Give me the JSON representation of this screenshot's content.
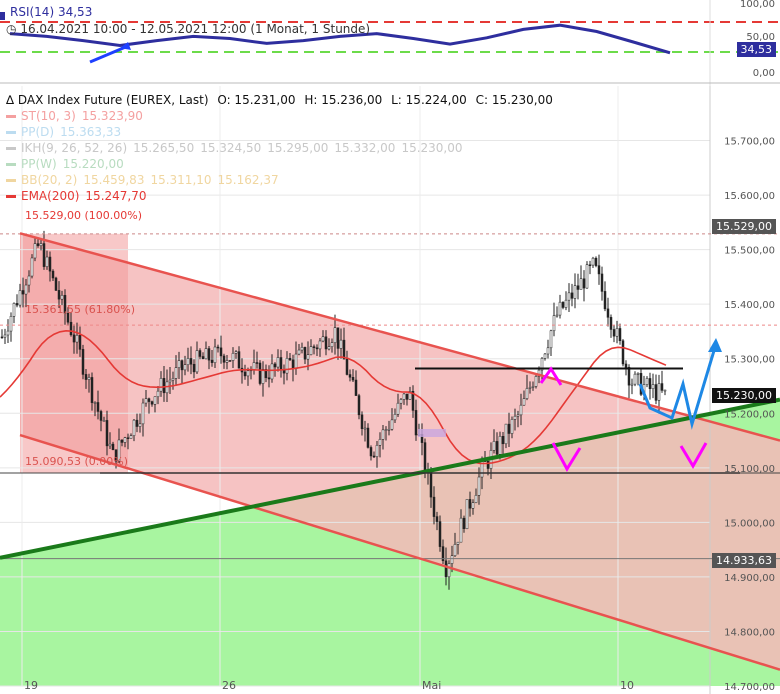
{
  "rsi": {
    "label": "RSI(14)",
    "value": "34,53",
    "period": "16.04.2021 10:00 - 12.05.2021 12:00",
    "resolution": "(1 Monat, 1 Stunde)",
    "axis_ticks": [
      "100,00",
      "50,00",
      "0,00"
    ],
    "badge": "34,53",
    "color": "#2e2e9e"
  },
  "main": {
    "title": "DAX Index Future (EUREX, Last)",
    "ohlc": {
      "o": "O: 15.231,00",
      "h": "H: 15.236,00",
      "l": "L: 15.224,00",
      "c": "C: 15.230,00"
    },
    "legend": [
      {
        "name": "ST(10, 3)",
        "vals": [
          "15.323,90"
        ],
        "color": "#f4a0a0"
      },
      {
        "name": "PP(D)",
        "vals": [
          "15.363,33"
        ],
        "color": "#bcdcf0"
      },
      {
        "name": "IKH(9, 26, 52, 26)",
        "vals": [
          "15.265,50",
          "15.324,50",
          "15.295,00",
          "15.332,00",
          "15.230,00"
        ],
        "color": "#c8c8c8"
      },
      {
        "name": "PP(W)",
        "vals": [
          "15.220,00"
        ],
        "color": "#b8dcc0"
      },
      {
        "name": "BB(20, 2)",
        "vals": [
          "15.459,83",
          "15.311,10",
          "15.162,37"
        ],
        "color": "#f0d6a0"
      },
      {
        "name": "EMA(200)",
        "vals": [
          "15.247,70"
        ],
        "color": "#e53935"
      }
    ],
    "fib_top": "15.529,00 (100.00%)",
    "fib_mid": "15.361,55 (61.80%)",
    "fib_low": "15.090,53 (0.00%)"
  },
  "tags": {
    "high": "15.529,00",
    "last": "15.230,00",
    "low": "14.933,63"
  },
  "colors": {
    "channel": "#e8534f",
    "trend": "#1a7a1a",
    "forecast": "#1e88e5",
    "arrows": "#ff00ff",
    "candles": "#222222",
    "green_area": "#a8f5a0",
    "pink_fill": "#f5b8b8"
  },
  "chart_data": {
    "type": "candlestick",
    "title": "DAX Index Future (EUREX, Last)",
    "x_ticks": [
      "19",
      "26",
      "Mai",
      "10"
    ],
    "y_ticks": [
      "15.700,00",
      "15.600,00",
      "15.500,00",
      "15.400,00",
      "15.300,00",
      "15.200,00",
      "15.100,00",
      "15.000,00",
      "14.900,00",
      "14.800,00",
      "14.700,00"
    ],
    "y_range": [
      14700,
      15800
    ],
    "price_series": [
      {
        "t": "16.04",
        "close": 15340
      },
      {
        "t": "19.04",
        "close": 15510
      },
      {
        "t": "20.04",
        "close": 15330
      },
      {
        "t": "21.04",
        "close": 15120
      },
      {
        "t": "22.04",
        "close": 15230
      },
      {
        "t": "23.04",
        "close": 15290
      },
      {
        "t": "26.04",
        "close": 15310
      },
      {
        "t": "27.04",
        "close": 15270
      },
      {
        "t": "28.04",
        "close": 15300
      },
      {
        "t": "29.04",
        "close": 15350
      },
      {
        "t": "30.04",
        "close": 15130
      },
      {
        "t": "03.05",
        "close": 15240
      },
      {
        "t": "04.05",
        "close": 14920
      },
      {
        "t": "05.05",
        "close": 15100
      },
      {
        "t": "06.05",
        "close": 15200
      },
      {
        "t": "07.05",
        "close": 15380
      },
      {
        "t": "10.05",
        "close": 15470
      },
      {
        "t": "11.05",
        "close": 15260
      },
      {
        "t": "12.05",
        "close": 15230
      }
    ],
    "rsi_series": [
      62,
      58,
      52,
      45,
      52,
      58,
      55,
      48,
      52,
      58,
      62,
      55,
      47,
      56,
      68,
      74,
      65,
      50,
      34.53
    ],
    "rsi_levels": {
      "overbought": 70,
      "oversold": 30
    },
    "annotations": {
      "fib_100": 15529.0,
      "fib_618": 15361.55,
      "fib_0": 15090.53,
      "last": 15230.0,
      "low": 14933.63
    }
  }
}
